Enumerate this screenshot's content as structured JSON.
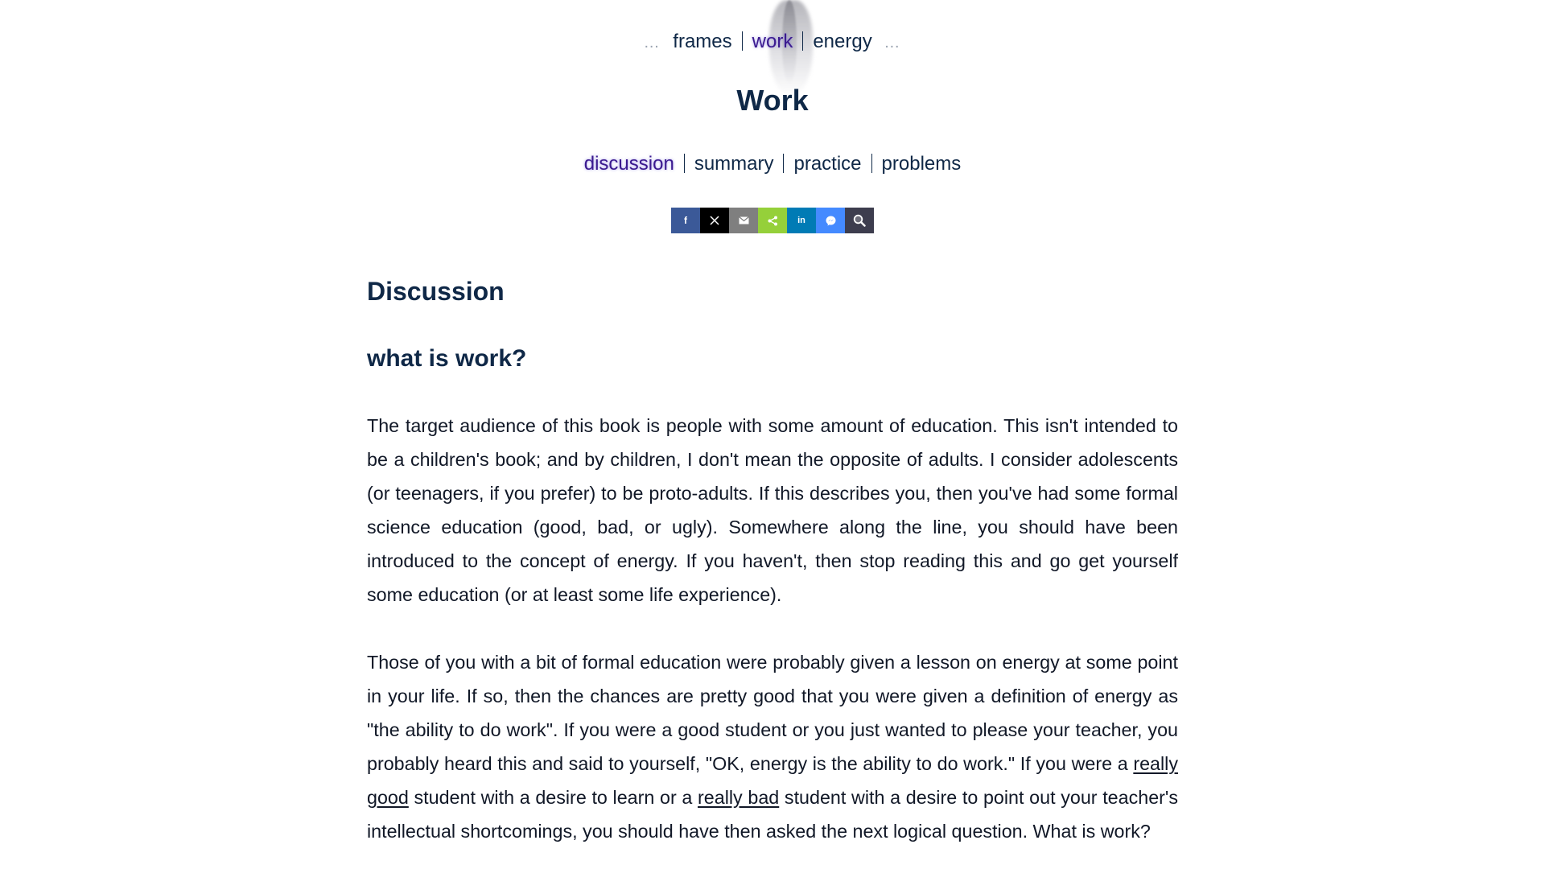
{
  "topnav": {
    "prev_dots": "…",
    "next_dots": "…",
    "items": [
      {
        "label": "frames"
      },
      {
        "label": "work"
      },
      {
        "label": "energy"
      }
    ]
  },
  "page_title": "Work",
  "subnav": {
    "items": [
      {
        "label": "discussion"
      },
      {
        "label": "summary"
      },
      {
        "label": "practice"
      },
      {
        "label": "problems"
      }
    ]
  },
  "share": {
    "buttons": [
      {
        "name": "facebook",
        "glyph": "f",
        "color": "#3b5998"
      },
      {
        "name": "x",
        "glyph": "𝕏",
        "color": "#000000"
      },
      {
        "name": "email",
        "glyph": "",
        "color": "#7f7f7f"
      },
      {
        "name": "share",
        "glyph": "",
        "color": "#95d03a"
      },
      {
        "name": "linkedin",
        "glyph": "in",
        "color": "#007bb5"
      },
      {
        "name": "messenger",
        "glyph": "",
        "color": "#448aff"
      },
      {
        "name": "search",
        "glyph": "",
        "color": "#3d3d4e"
      }
    ]
  },
  "content": {
    "heading": "Discussion",
    "subheading": "what is work?",
    "p1": "The target audience of this book is people with some amount of education. This isn't intended to be a children's book; and by children, I don't mean the opposite of adults. I consider adolescents (or teenagers, if you prefer) to be proto-adults. If this describes you, then you've had some formal science education (good, bad, or ugly). Somewhere along the line, you should have been introduced to the concept of energy. If you haven't, then stop reading this and go get yourself some education (or at least some life experience).",
    "p2_a": "Those of you with a bit of formal education were probably given a lesson on energy at some point in your life. If so, then the chances are pretty good that you were given a definition of energy as \"the ability to do work\". If you were a good student or you just wanted to please your teacher, you probably heard this and said to yourself, \"OK, energy is the ability to do work.\" If you were a ",
    "p2_link1": "really good",
    "p2_b": " student with a desire to learn or a ",
    "p2_link2": "really bad",
    "p2_c": " student with a desire to point out your teacher's intellectual shortcomings, you should have then asked the next logical question. What is work?"
  }
}
